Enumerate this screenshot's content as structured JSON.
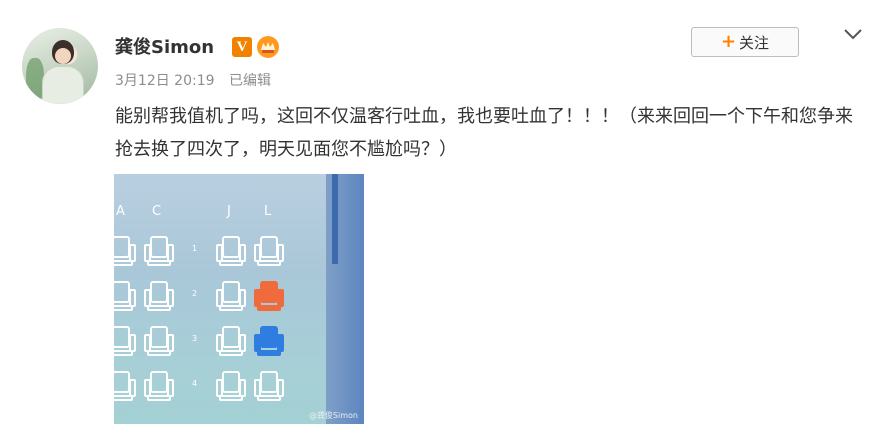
{
  "post": {
    "username": "龚俊Simon",
    "verified_badge": "V",
    "vip_icon": "vip-crown-icon",
    "date": "3月12日 20:19",
    "edited": "已编辑",
    "follow_label": "关注",
    "follow_plus": "+",
    "content": "能别帮我值机了吗，这回不仅温客行吐血，我也要吐血了！！！（来来回回一个下午和您争来抢去换了四次了，明天见面您不尴尬吗？）"
  },
  "image": {
    "column_labels": [
      "A",
      "C",
      "J",
      "L"
    ],
    "row_labels": [
      "1",
      "2",
      "3",
      "4"
    ],
    "watermark": "@龚俊Simon",
    "seat_colors": {
      "selected_red": "#ef6b3b",
      "selected_blue": "#2f7de0"
    }
  },
  "colors": {
    "accent_orange": "#ff8200",
    "meta_gray": "#8d8d8d",
    "text": "#333333"
  }
}
